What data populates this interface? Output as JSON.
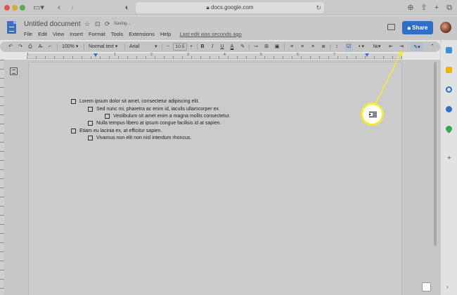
{
  "browser": {
    "url": "docs.google.com",
    "back_icon": "chevron-left-icon",
    "forward_icon": "chevron-right-icon"
  },
  "doc": {
    "title": "Untitled document",
    "status": "Saving...",
    "last_edit": "Last edit was seconds ago",
    "share_label": "Share"
  },
  "menu": [
    "File",
    "Edit",
    "View",
    "Insert",
    "Format",
    "Tools",
    "Extensions",
    "Help"
  ],
  "toolbar": {
    "zoom": "100%",
    "style": "Normal text",
    "font": "Arial",
    "font_size": "10.5",
    "bold": "B",
    "italic": "I",
    "underline": "U",
    "text_color": "A"
  },
  "ruler": {
    "numbers": [
      "1",
      "1",
      "2",
      "3",
      "4",
      "5",
      "6",
      "7"
    ]
  },
  "checklist": [
    {
      "text": "Lorem ipsum dolor sit amet, consectetur adipiscing elit.",
      "level": 0
    },
    {
      "text": "Sed nunc mi, pharetra ac enim id, iaculis ullamcorper ex.",
      "level": 1
    },
    {
      "text": "Vestibulum sit amet enim a magna mollis consectetur.",
      "level": 2
    },
    {
      "text": "Nulla tempus libero at ipsum congue facilisis id at sapien.",
      "level": 1
    },
    {
      "text": "Etiam eu lacinia ex, at efficitur sapien.",
      "level": 0
    },
    {
      "text": "Vivamus non elit non nisl interdum rhoncus.",
      "level": 1
    }
  ],
  "callout": {
    "icon": "increase-indent-icon",
    "color": "#f3ec33"
  },
  "colors": {
    "accent": "#2f6fc9",
    "docs_blue": "#3a6fc4"
  }
}
